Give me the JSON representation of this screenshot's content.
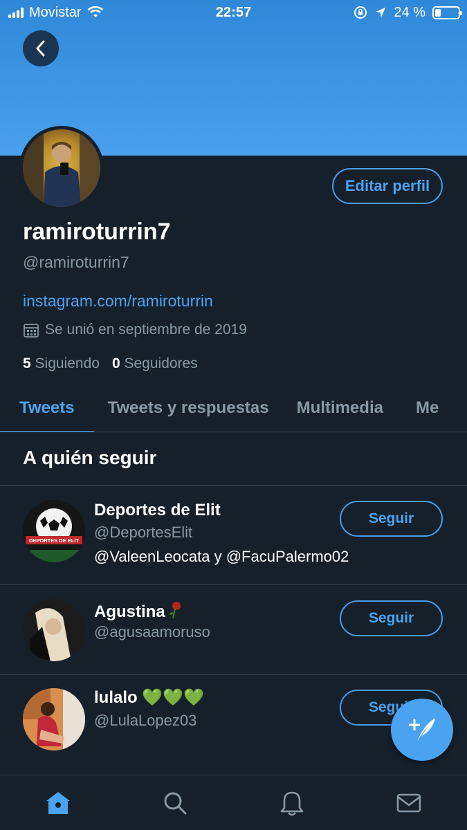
{
  "status_bar": {
    "carrier": "Movistar",
    "time": "22:57",
    "battery": "24 %",
    "battery_level": 0.24
  },
  "profile": {
    "display_name": "ramiroturrin7",
    "handle": "@ramiroturrin7",
    "link": "instagram.com/ramiroturrin",
    "joined": "Se unió en septiembre de 2019",
    "following_count": "5",
    "following_label": "Siguiendo",
    "followers_count": "0",
    "followers_label": "Seguidores",
    "edit_button": "Editar perfil"
  },
  "tabs": [
    {
      "label": "Tweets",
      "active": true
    },
    {
      "label": "Tweets y respuestas",
      "active": false
    },
    {
      "label": "Multimedia",
      "active": false
    },
    {
      "label": "Me",
      "active": false
    }
  ],
  "who_to_follow": {
    "title": "A quién seguir",
    "items": [
      {
        "name": "Deportes de Elit",
        "handle": "@DeportesElit",
        "context": "@ValeenLeocata y @FacuPalermo02",
        "button": "Seguir",
        "avatar_text": "DEPORTES DE ELIT"
      },
      {
        "name": "Agustina",
        "handle": "@agusaamoruso",
        "context": "",
        "button": "Seguir"
      },
      {
        "name": "lulalo",
        "hearts": "💚💚💚",
        "handle": "@LulaLopez03",
        "context": "",
        "button": "Seguir"
      }
    ]
  },
  "colors": {
    "background": "#15202b",
    "accent": "#4aa3f0",
    "banner": "#4aa0ec",
    "muted_text": "#8899a6",
    "divider": "#38444d"
  },
  "icons": {
    "back": "chevron-left-icon",
    "calendar": "calendar-icon",
    "compose": "compose-tweet-icon",
    "nav": [
      "home-icon",
      "search-icon",
      "notifications-icon",
      "messages-icon"
    ]
  }
}
